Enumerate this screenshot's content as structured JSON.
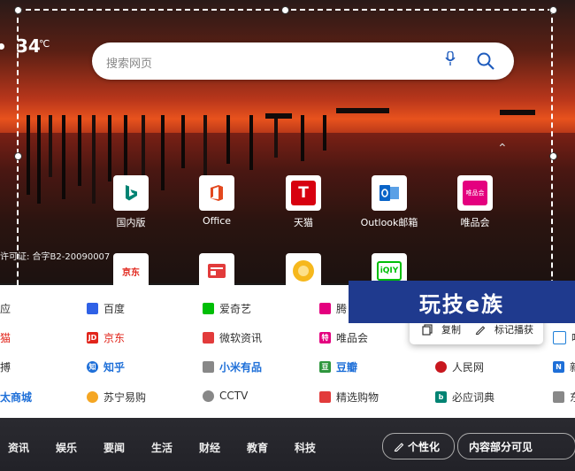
{
  "weather": {
    "temp": "34",
    "unit": "℃"
  },
  "search": {
    "placeholder": "搜索网页"
  },
  "tiles": [
    {
      "label": "国内版",
      "icon": "bing-icon"
    },
    {
      "label": "Office",
      "icon": "office-icon"
    },
    {
      "label": "天猫",
      "icon": "tmall-icon"
    },
    {
      "label": "Outlook邮箱",
      "icon": "outlook-icon"
    },
    {
      "label": "唯品会",
      "icon": "vip-icon"
    },
    {
      "label": "京东",
      "icon": "jd-icon"
    }
  ],
  "tile_row2_icons": [
    "jd-icon",
    "news-icon",
    "lion-icon",
    "iqiyi-icon"
  ],
  "licence": "许可证: 合字B2-20090007",
  "sites": {
    "row1": [
      "应",
      "百度",
      "爱奇艺",
      "腾"
    ],
    "row2": [
      "猫",
      "京东",
      "微软资讯",
      "唯品会",
      "吗"
    ],
    "row3": [
      "搏",
      "知乎",
      "小米有品",
      "豆瓣",
      "人民网",
      "新"
    ],
    "row4": [
      "太商城",
      "苏宁易购",
      "CCTV",
      "精选购物",
      "必应词典",
      "东"
    ]
  },
  "ctx_menu": {
    "copy": "复制",
    "mark": "标记播获"
  },
  "watermark": "玩技e族",
  "bottom_nav": {
    "tabs": [
      "资讯",
      "娱乐",
      "要闻",
      "生活",
      "财经",
      "教育",
      "科技"
    ],
    "personalize": "个性化",
    "visibility": "内容部分可见"
  },
  "colors": {
    "accent_blue": "#1e5bbd",
    "tmall_red": "#d7000f",
    "vip_pink": "#e4007f",
    "watermark_bg": "#1f3a8e"
  }
}
